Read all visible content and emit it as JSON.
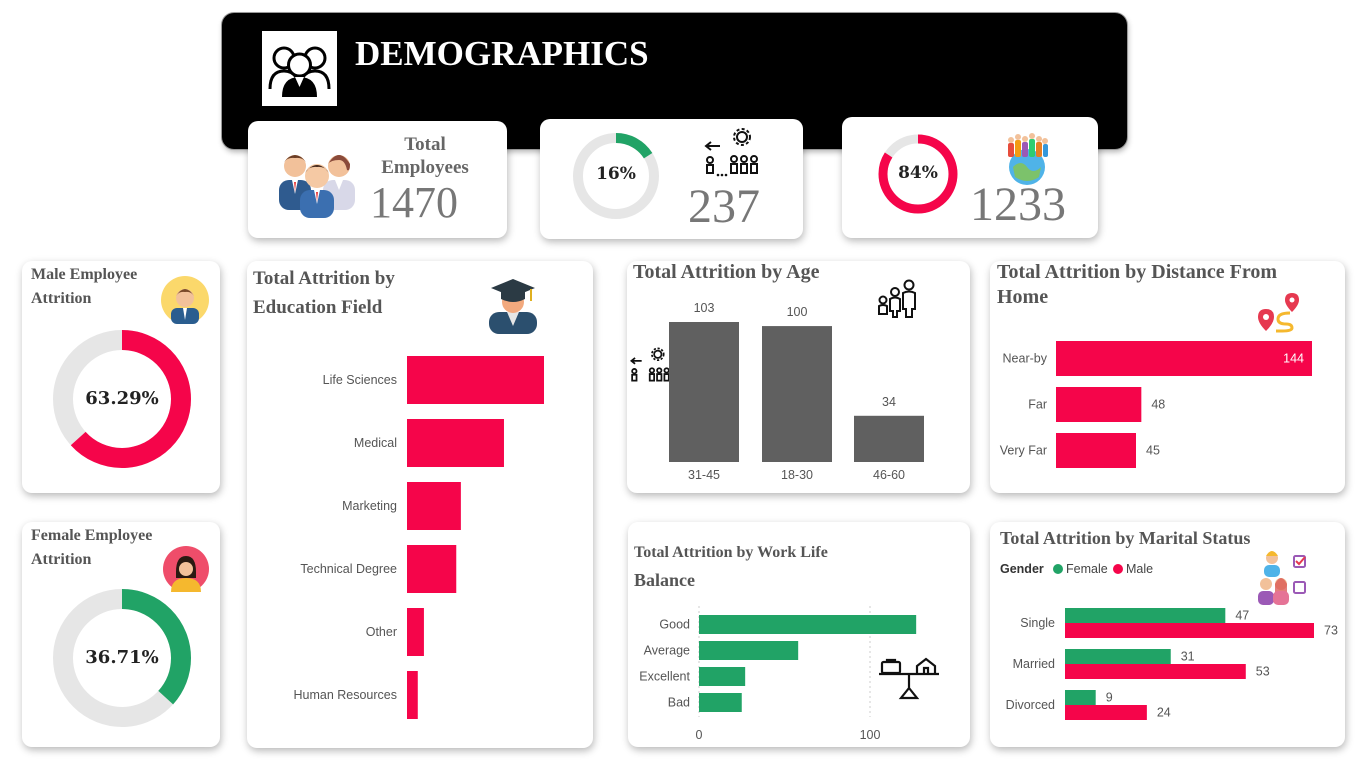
{
  "header": {
    "title": "DEMOGRAPHICS",
    "icon": "people-group-icon",
    "background": "#000000"
  },
  "kpis": {
    "total": {
      "label": "Total Employees",
      "value": "1470",
      "icon": "employees-icon"
    },
    "attrition": {
      "percent_label": "16%",
      "percent": 16,
      "value": "237",
      "icon": "leaving-employees-icon"
    },
    "retained": {
      "percent_label": "84%",
      "percent": 84,
      "value": "1233",
      "icon": "workforce-globe-icon"
    }
  },
  "male_attrition": {
    "title_line1": "Male Employee",
    "title_line2": "Attrition",
    "value_label": "63.29%",
    "percent": 63.29,
    "icon": "male-avatar-icon"
  },
  "female_attrition": {
    "title_line1": "Female Employee",
    "title_line2": "Attrition",
    "value_label": "36.71%",
    "percent": 36.71,
    "icon": "female-avatar-icon"
  },
  "education": {
    "title_line1": "Total Attrition by",
    "title_line2": "Education Field",
    "icon": "graduate-icon",
    "chart_data": {
      "type": "bar",
      "orientation": "horizontal",
      "categories": [
        "Life Sciences",
        "Medical",
        "Marketing",
        "Technical Degree",
        "Other",
        "Human Resources"
      ],
      "values": [
        89,
        63,
        35,
        32,
        11,
        7
      ],
      "xlim": [
        0,
        89
      ]
    }
  },
  "age": {
    "title": "Total Attrition by Age",
    "icon": "family-icon",
    "side_icon": "leaving-employees-icon",
    "chart_data": {
      "type": "bar",
      "categories": [
        "31-45",
        "18-30",
        "46-60"
      ],
      "values": [
        103,
        100,
        34
      ],
      "ylim": [
        0,
        103
      ]
    }
  },
  "distance": {
    "title_line1": "Total Attrition by Distance From",
    "title_line2": "Home",
    "icon": "route-pin-icon",
    "chart_data": {
      "type": "bar",
      "orientation": "horizontal",
      "categories": [
        "Near-by",
        "Far",
        "Very Far"
      ],
      "values": [
        144,
        48,
        45
      ],
      "xlim": [
        0,
        144
      ]
    }
  },
  "worklife": {
    "title_line1": "Total Attrition by Work Life",
    "title_line2": "Balance",
    "icon": "work-home-balance-icon",
    "chart_data": {
      "type": "bar",
      "orientation": "horizontal",
      "categories": [
        "Good",
        "Average",
        "Excellent",
        "Bad"
      ],
      "values": [
        127,
        58,
        27,
        25
      ],
      "xticks": [
        "0",
        "100"
      ],
      "xlim": [
        0,
        100
      ]
    }
  },
  "marital": {
    "title": "Total Attrition by Marital Status",
    "legend_title": "Gender",
    "icon": "couple-checklist-icon",
    "chart_data": {
      "type": "bar",
      "orientation": "horizontal",
      "categories": [
        "Single",
        "Married",
        "Divorced"
      ],
      "series": [
        {
          "name": "Female",
          "values": [
            47,
            31,
            9
          ]
        },
        {
          "name": "Male",
          "values": [
            73,
            53,
            24
          ]
        }
      ],
      "xlim": [
        0,
        73
      ]
    }
  },
  "colors": {
    "red": "#f5054a",
    "green": "#21a366",
    "gray": "#606060",
    "light": "#e6e6e6"
  }
}
